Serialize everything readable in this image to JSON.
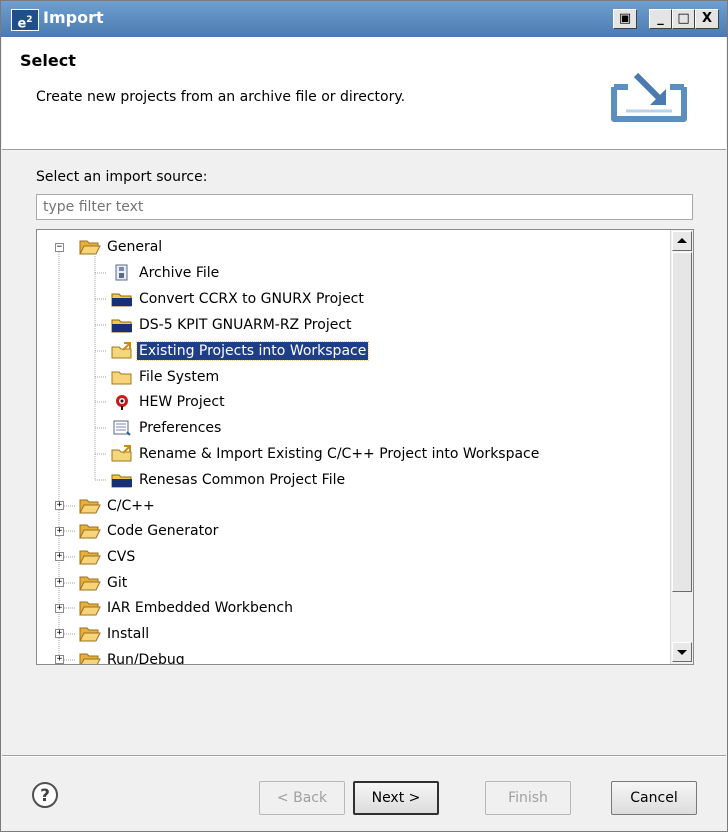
{
  "window": {
    "app_icon": "e",
    "app_icon_sup": "2",
    "title": "Import",
    "controls": {
      "restore": "▣",
      "minimize": "_",
      "maximize": "□",
      "close": "X"
    }
  },
  "header": {
    "title": "Select",
    "description": "Create new projects from an archive file or directory.",
    "icon": "import-wizard-icon"
  },
  "source": {
    "label": "Select an import source:",
    "filter_placeholder": "type filter text",
    "filter_value": ""
  },
  "tree": {
    "general": {
      "label": "General",
      "children": [
        {
          "label": "Archive File",
          "icon": "archive-file-icon"
        },
        {
          "label": "Convert CCRX to GNURX Project",
          "icon": "project-folder-icon"
        },
        {
          "label": "DS-5 KPIT GNUARM-RZ Project",
          "icon": "project-folder-icon"
        },
        {
          "label": "Existing Projects into Workspace",
          "icon": "import-projects-icon",
          "selected": true
        },
        {
          "label": "File System",
          "icon": "folder-icon"
        },
        {
          "label": "HEW Project",
          "icon": "hew-project-icon"
        },
        {
          "label": "Preferences",
          "icon": "preferences-icon"
        },
        {
          "label": "Rename & Import Existing C/C++ Project into Workspace",
          "icon": "import-projects-icon"
        },
        {
          "label": "Renesas Common Project File",
          "icon": "project-folder-icon"
        }
      ]
    },
    "categories": [
      {
        "label": "C/C++"
      },
      {
        "label": "Code Generator"
      },
      {
        "label": "CVS"
      },
      {
        "label": "Git"
      },
      {
        "label": "IAR Embedded Workbench"
      },
      {
        "label": "Install"
      },
      {
        "label": "Run/Debug"
      }
    ]
  },
  "buttons": {
    "help": "?",
    "back": "< Back",
    "next": "Next >",
    "finish": "Finish",
    "cancel": "Cancel"
  },
  "colors": {
    "selection": "#1e3f88",
    "title_bar": "#4a7ab0",
    "folder": "#f5c84a"
  }
}
